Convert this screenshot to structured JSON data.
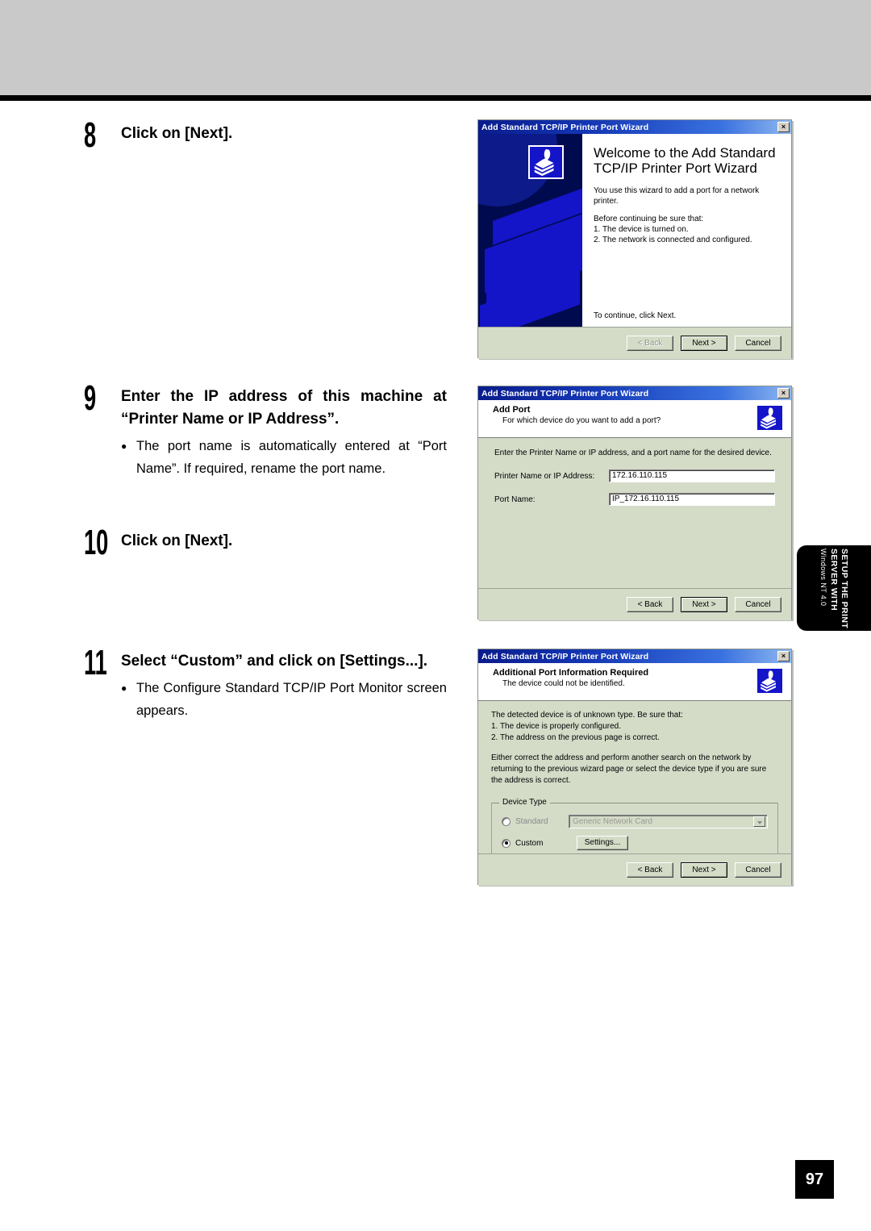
{
  "page": {
    "number": "97",
    "side_tab": {
      "line1": "SETUP THE PRINT",
      "line2": "SERVER WITH",
      "line3": "Windows NT 4.0"
    }
  },
  "steps": [
    {
      "number": "8",
      "title": "Click on [Next].",
      "note": ""
    },
    {
      "number": "9",
      "title": "Enter the IP address of this machine at “Printer Name or IP Address”.",
      "note": "The port name is automatically entered at “Port Name”.  If required, rename the port name."
    },
    {
      "number": "10",
      "title": "Click on [Next].",
      "note": ""
    },
    {
      "number": "11",
      "title": "Select “Custom” and click on [Settings...].",
      "note": "The Configure Standard TCP/IP Port Monitor screen appears."
    }
  ],
  "dialogs": {
    "welcome": {
      "title": "Add Standard TCP/IP Printer Port Wizard",
      "close_label": "×",
      "heading_line1": "Welcome to the Add Standard",
      "heading_line2": "TCP/IP Printer Port Wizard",
      "intro": "You use this wizard to add a port for a network printer.",
      "before_label": "Before continuing be sure that:",
      "bullets": [
        "1.  The device is turned on.",
        "2.  The network is connected and configured."
      ],
      "footer_hint": "To continue, click Next.",
      "buttons": {
        "back": "< Back",
        "next": "Next >",
        "cancel": "Cancel"
      }
    },
    "add_port": {
      "title": "Add Standard TCP/IP Printer Port Wizard",
      "close_label": "×",
      "head_title": "Add Port",
      "head_sub": "For which device do you want to add a port?",
      "intro": "Enter the Printer Name or IP address, and a port name for the desired device.",
      "fields": [
        {
          "label": "Printer Name or IP Address:",
          "value": "172.16.110.115"
        },
        {
          "label": "Port Name:",
          "value": "IP_172.16.110.115"
        }
      ],
      "buttons": {
        "back": "< Back",
        "next": "Next >",
        "cancel": "Cancel"
      }
    },
    "additional_info": {
      "title": "Add Standard TCP/IP Printer Port Wizard",
      "close_label": "×",
      "head_title": "Additional Port Information Required",
      "head_sub": "The device could not be identified.",
      "msg1_line1": "The detected device is of unknown type.  Be sure that:",
      "msg1_line2": "1.  The device is properly configured.",
      "msg1_line3": "2.  The address on the previous page is correct.",
      "msg2": "Either correct the address and perform another search on the network by returning to the previous wizard page or select the device type if you are sure the address is correct.",
      "group_legend": "Device Type",
      "standard_label": "Standard",
      "standard_value": "Generic Network Card",
      "custom_label": "Custom",
      "settings_label": "Settings...",
      "selected_device_type": "Custom",
      "buttons": {
        "back": "< Back",
        "next": "Next >",
        "cancel": "Cancel"
      }
    }
  },
  "colors": {
    "titlebar_start": "#0a1c8c",
    "titlebar_end": "#8fb8f0",
    "dialog_face": "#d4dcc8",
    "banner_navy": "#000a4e",
    "banner_blue": "#1414c8",
    "header_band": "#c9c9c9"
  }
}
